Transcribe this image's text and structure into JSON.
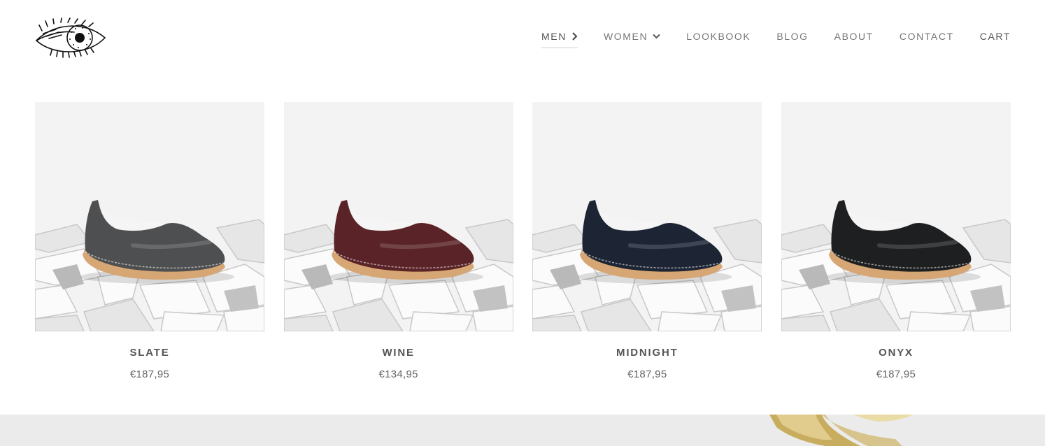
{
  "header": {
    "logo_icon": "eye-logo-icon",
    "nav": [
      {
        "label": "MEN",
        "icon": "chevron-right-icon",
        "active": true
      },
      {
        "label": "WOMEN",
        "icon": "chevron-down-icon",
        "active": false
      },
      {
        "label": "LOOKBOOK",
        "active": false
      },
      {
        "label": "BLOG",
        "active": false
      },
      {
        "label": "ABOUT",
        "active": false
      },
      {
        "label": "CONTACT",
        "active": false
      },
      {
        "label": "CART",
        "active": false
      }
    ]
  },
  "products": [
    {
      "name": "SLATE",
      "price": "€187,95",
      "color": "#4e4f50"
    },
    {
      "name": "WINE",
      "price": "€134,95",
      "color": "#5a2327"
    },
    {
      "name": "MIDNIGHT",
      "price": "€187,95",
      "color": "#1d2535"
    },
    {
      "name": "ONYX",
      "price": "€187,95",
      "color": "#1e1f21"
    }
  ],
  "banner": {
    "icon": "banner-shoe-image"
  }
}
